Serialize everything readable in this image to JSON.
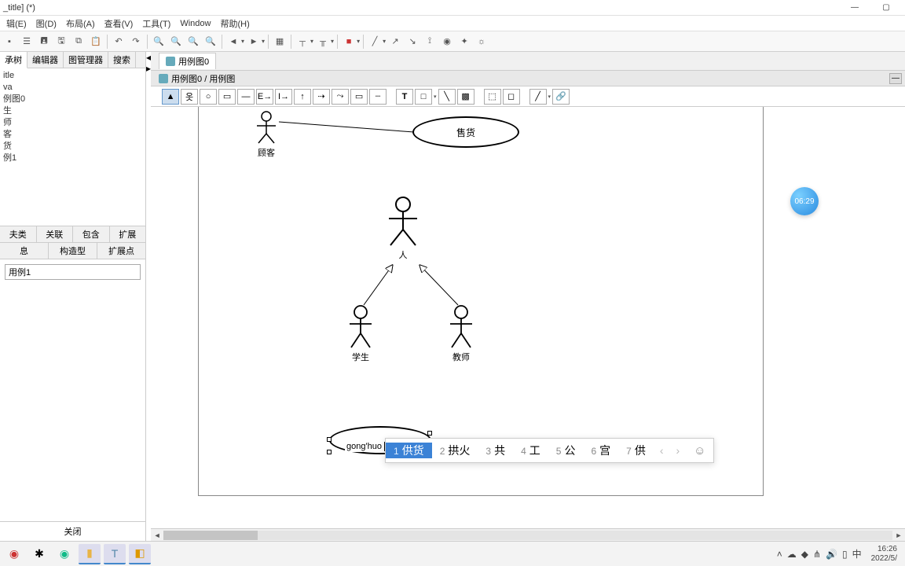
{
  "window_title": "_title] (*)",
  "menu": [
    "辑(E)",
    "图(D)",
    "布局(A)",
    "查看(V)",
    "工具(T)",
    "Window",
    "帮助(H)"
  ],
  "left_tabs": [
    "承树",
    "编辑器",
    "图管理器",
    "搜索"
  ],
  "tree_nodes": [
    "itle",
    "va",
    "例图0",
    "",
    "生",
    "师",
    "客",
    "货",
    "例1"
  ],
  "mid_tabs_row1": [
    "夫类",
    "关联",
    "包含",
    "扩展"
  ],
  "mid_tabs_row2": [
    "息",
    "构造型",
    "扩展点"
  ],
  "selected_element": "用例1",
  "close_button": "关闭",
  "editor_tab": "用例图0",
  "breadcrumb": "用例图0 / 用例图",
  "actors": {
    "customer": "顾客",
    "person": "人",
    "student": "学生",
    "teacher": "教师"
  },
  "usecases": {
    "sell": "售货"
  },
  "editing_text": "gong'huo",
  "ime_candidates": [
    {
      "n": "1",
      "t": "供货"
    },
    {
      "n": "2",
      "t": "拱火"
    },
    {
      "n": "3",
      "t": "共"
    },
    {
      "n": "4",
      "t": "工"
    },
    {
      "n": "5",
      "t": "公"
    },
    {
      "n": "6",
      "t": "宫"
    },
    {
      "n": "7",
      "t": "供"
    }
  ],
  "clock_badge": "06:29",
  "tray_time": "16:26",
  "tray_date": "2022/5/",
  "tray_ime": "中"
}
